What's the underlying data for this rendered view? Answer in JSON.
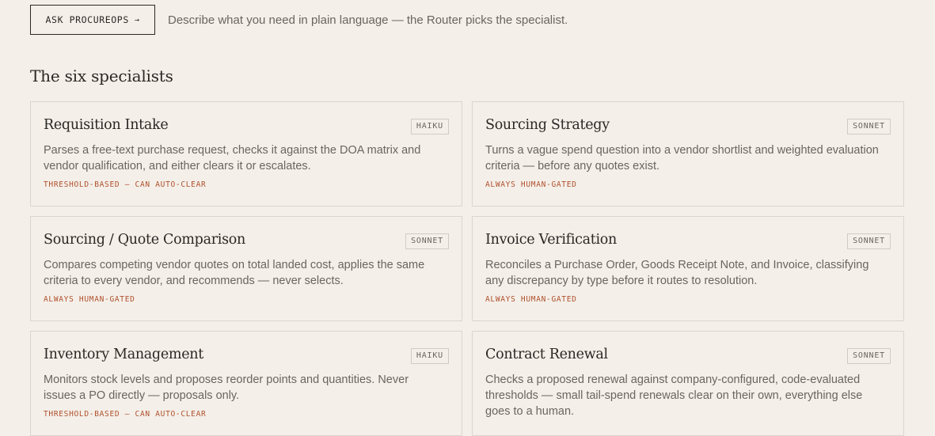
{
  "ask_button": {
    "label": "ASK PROCUREOPS",
    "arrow": "→"
  },
  "tagline": "Describe what you need in plain language — the Router picks the specialist.",
  "section_title": "The six specialists",
  "specialists": [
    {
      "title": "Requisition Intake",
      "model": "HAIKU",
      "description": "Parses a free-text purchase request, checks it against the DOA matrix and vendor qualification, and either clears it or escalates.",
      "gate": "THRESHOLD-BASED — CAN AUTO-CLEAR"
    },
    {
      "title": "Sourcing Strategy",
      "model": "SONNET",
      "description": "Turns a vague spend question into a vendor shortlist and weighted evaluation criteria — before any quotes exist.",
      "gate": "ALWAYS HUMAN-GATED"
    },
    {
      "title": "Sourcing / Quote Comparison",
      "model": "SONNET",
      "description": "Compares competing vendor quotes on total landed cost, applies the same criteria to every vendor, and recommends — never selects.",
      "gate": "ALWAYS HUMAN-GATED"
    },
    {
      "title": "Invoice Verification",
      "model": "SONNET",
      "description": "Reconciles a Purchase Order, Goods Receipt Note, and Invoice, classifying any discrepancy by type before it routes to resolution.",
      "gate": "ALWAYS HUMAN-GATED"
    },
    {
      "title": "Inventory Management",
      "model": "HAIKU",
      "description": "Monitors stock levels and proposes reorder points and quantities. Never issues a PO directly — proposals only.",
      "gate": "THRESHOLD-BASED — CAN AUTO-CLEAR"
    },
    {
      "title": "Contract Renewal",
      "model": "SONNET",
      "description": "Checks a proposed renewal against company-configured, code-evaluated thresholds — small tail-spend renewals clear on their own, everything else goes to a human.",
      "gate": ""
    }
  ]
}
